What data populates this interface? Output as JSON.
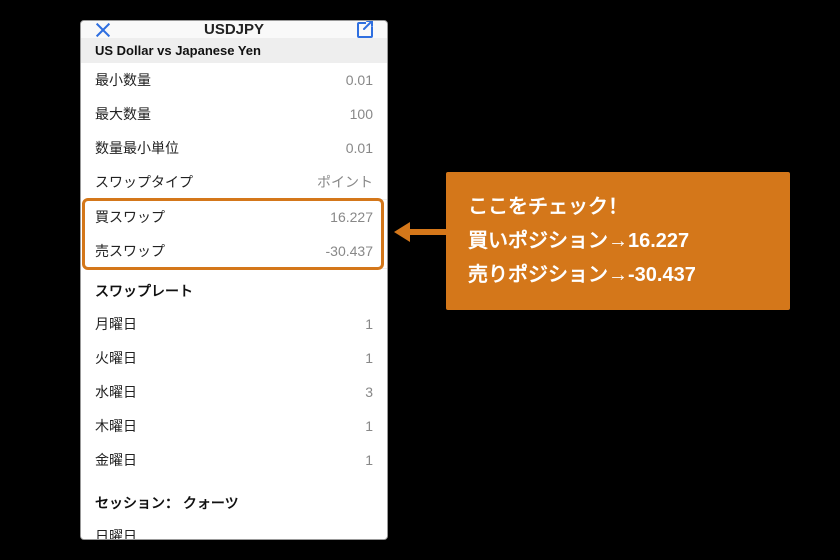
{
  "header": {
    "title": "USDJPY"
  },
  "section1": {
    "title": "US Dollar vs Japanese Yen",
    "rows": [
      {
        "label": "最小数量",
        "value": "0.01"
      },
      {
        "label": "最大数量",
        "value": "100"
      },
      {
        "label": "数量最小単位",
        "value": "0.01"
      },
      {
        "label": "スワップタイプ",
        "value": "ポイント"
      },
      {
        "label": "買スワップ",
        "value": "16.227"
      },
      {
        "label": "売スワップ",
        "value": "-30.437"
      }
    ]
  },
  "section2": {
    "title": "スワップレート",
    "rows": [
      {
        "label": "月曜日",
        "value": "1"
      },
      {
        "label": "火曜日",
        "value": "1"
      },
      {
        "label": "水曜日",
        "value": "3"
      },
      {
        "label": "木曜日",
        "value": "1"
      },
      {
        "label": "金曜日",
        "value": "1"
      }
    ]
  },
  "section3": {
    "title": "セッション： クォーツ",
    "rows": [
      {
        "label": "日曜日",
        "value": ""
      }
    ]
  },
  "callout": {
    "line1": "ここをチェック！",
    "line2": "買いポジション→16.227",
    "line3": "売りポジション→-30.437"
  }
}
